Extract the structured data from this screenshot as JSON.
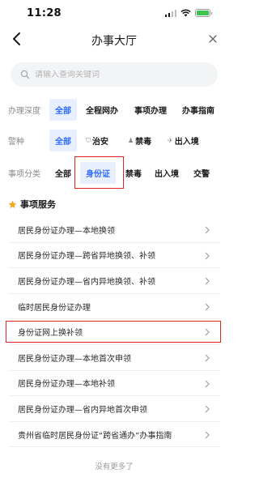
{
  "status": {
    "time": "11:28"
  },
  "nav": {
    "title": "办事大厅"
  },
  "search": {
    "placeholder": "请输入查询关键词"
  },
  "filters": [
    {
      "label": "办理深度",
      "options": [
        "全部",
        "全程网办",
        "事项办理",
        "办事指南"
      ],
      "selected": 0
    },
    {
      "label": "警种",
      "options": [
        "全部",
        "治安",
        "禁毒",
        "出入境"
      ],
      "selected": 0,
      "icons": [
        "",
        "shield-icon",
        "person-icon",
        "plane-icon"
      ]
    },
    {
      "label": "事项分类",
      "options": [
        "全部",
        "身份证",
        "禁毒",
        "出入境",
        "交警"
      ],
      "selected": 1
    }
  ],
  "section": {
    "title": "事项服务"
  },
  "services": [
    "居民身份证办理—本地换领",
    "居民身份证办理—跨省异地换领、补领",
    "居民身份证办理—省内异地换领、补领",
    "临时居民身份证办理",
    "身份证网上换补领",
    "居民身份证办理—本地首次申领",
    "居民身份证办理—本地补领",
    "居民身份证办理—省内异地首次申领",
    "贵州省临时居民身份证“跨省通办”办事指南"
  ],
  "footer": {
    "no_more": "没有更多了"
  },
  "colors": {
    "accent": "#2f6bff",
    "highlight": "#e0271f",
    "star": "#f5a623"
  }
}
